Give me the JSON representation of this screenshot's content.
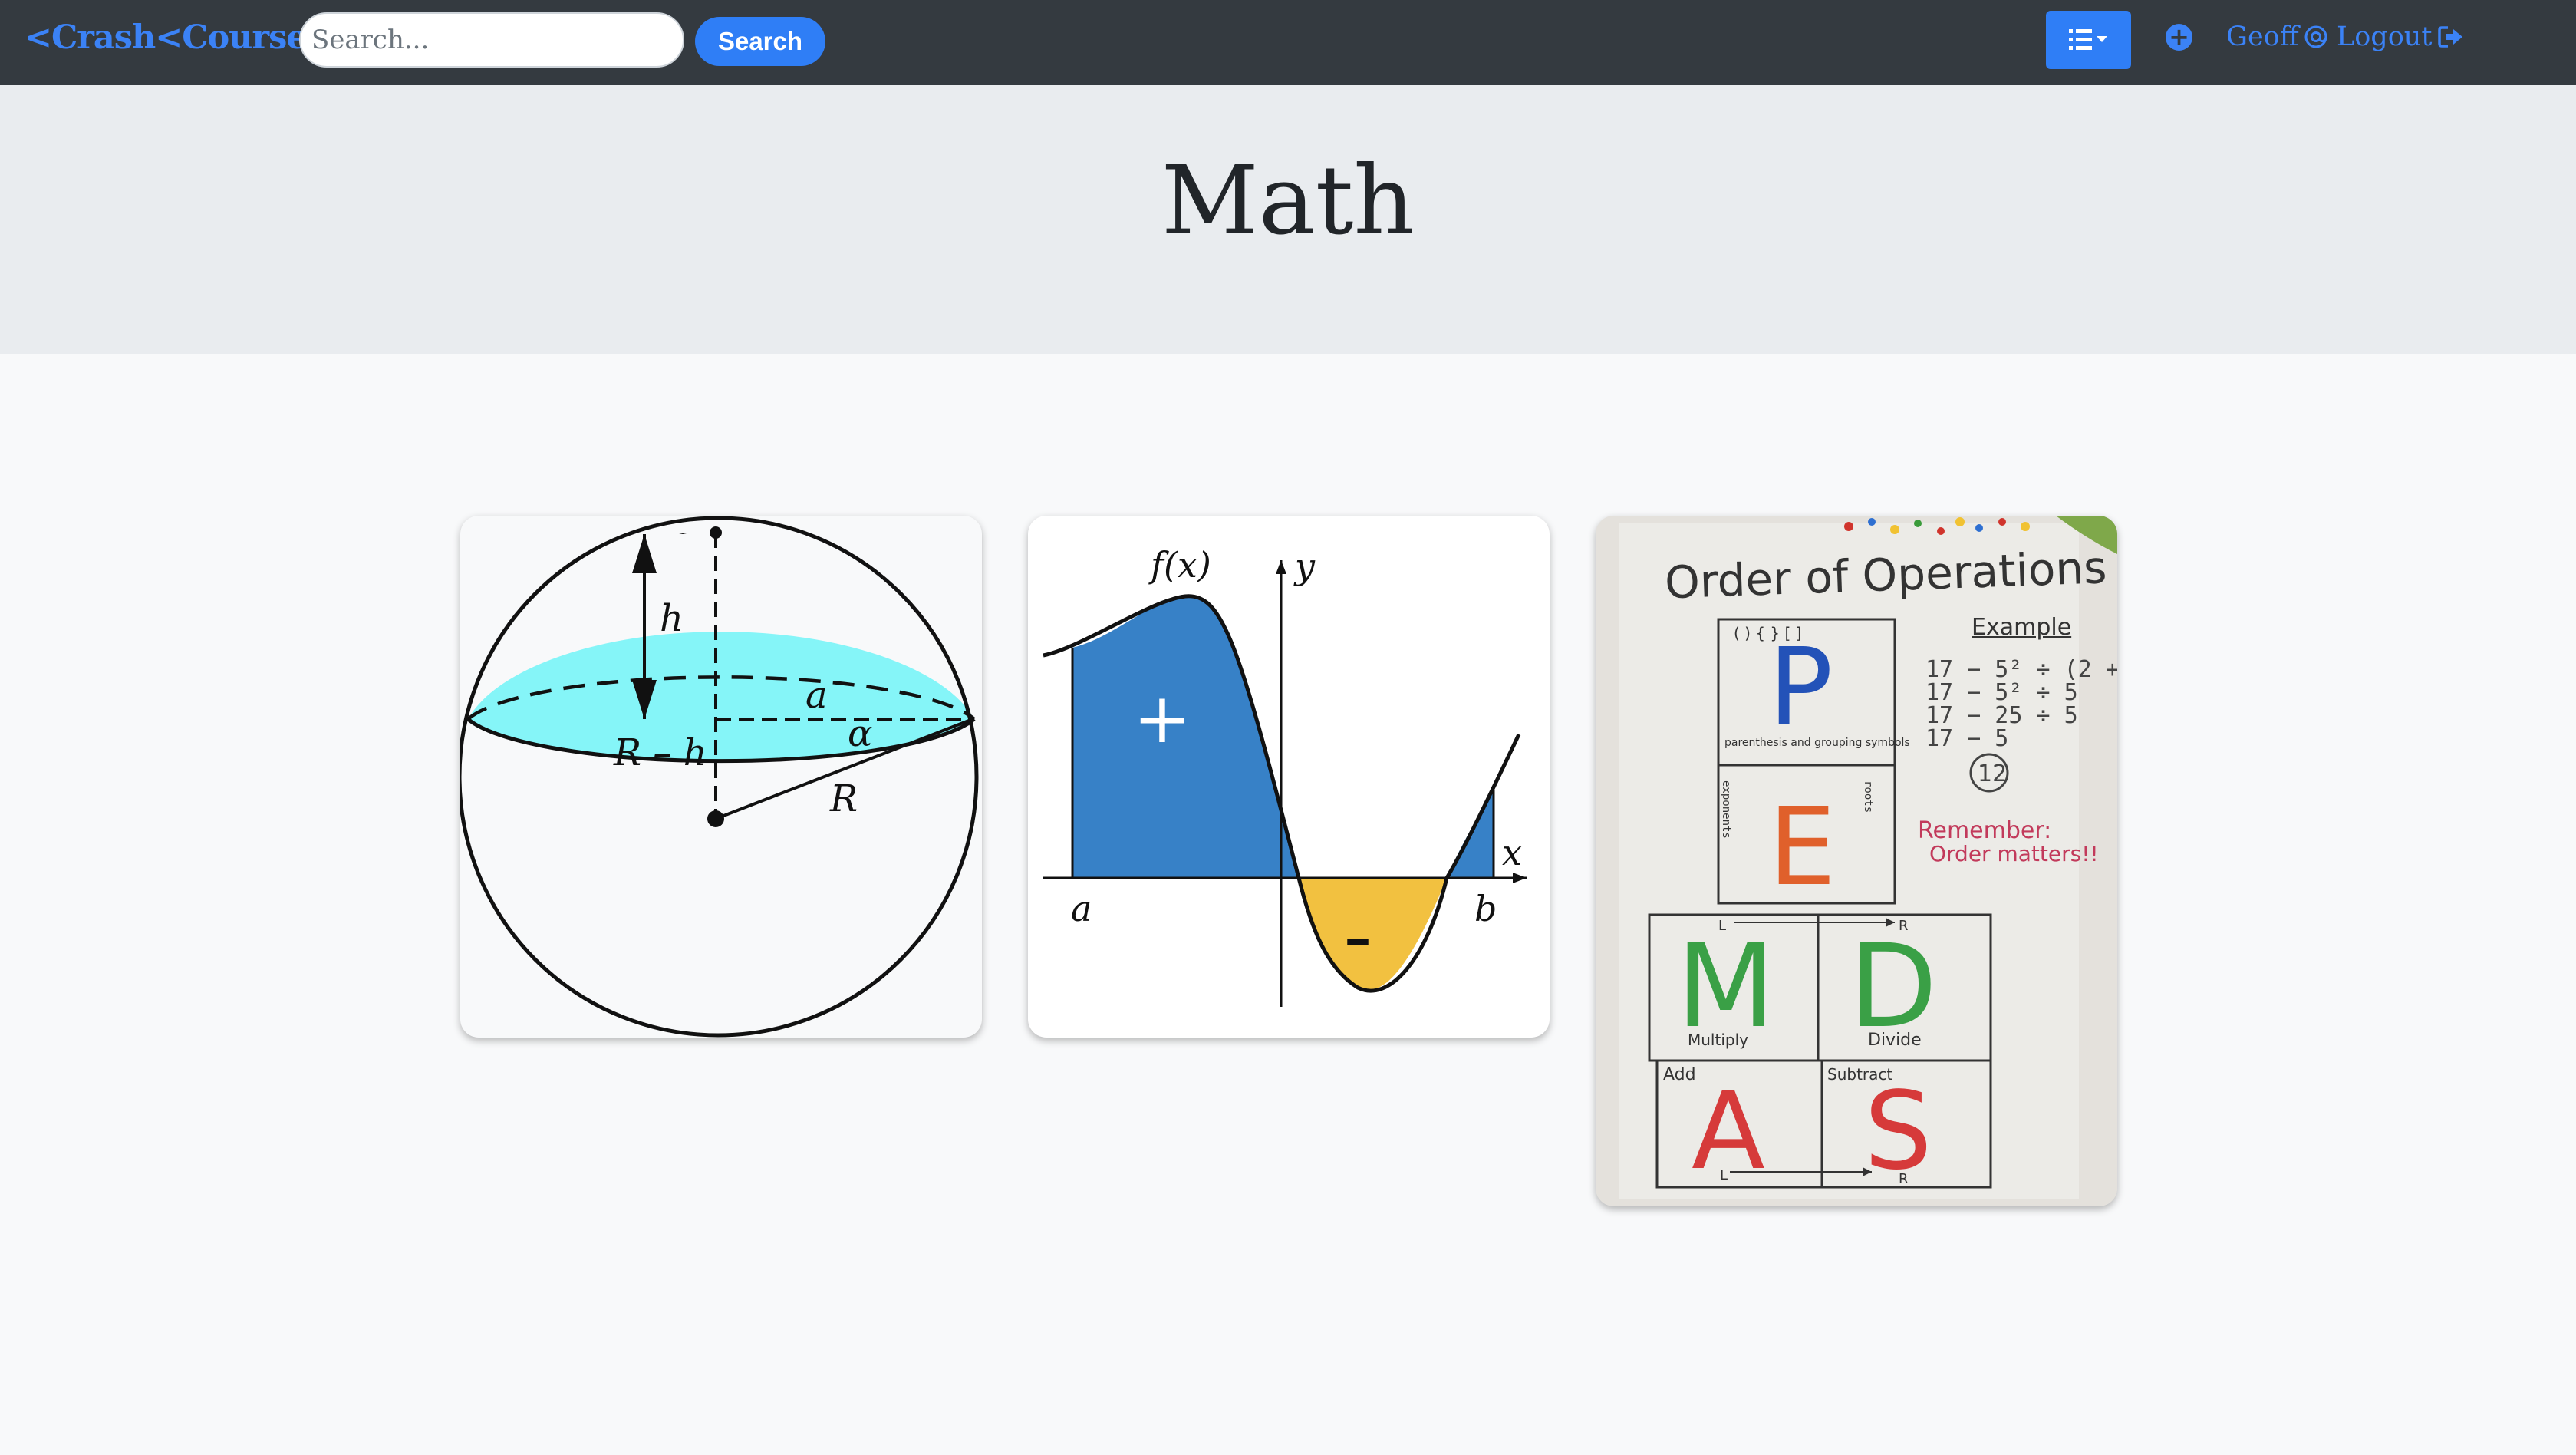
{
  "navbar": {
    "brand": "<Crash<Course",
    "search_placeholder": "Search...",
    "search_label": "Search",
    "user_label": "Geoff",
    "logout_label": "Logout"
  },
  "page": {
    "title": "Math"
  },
  "icons": {
    "menu": "list-icon",
    "add": "plus-circle-icon",
    "user": "at-icon",
    "logout": "sign-out-icon"
  },
  "colors": {
    "navbar_bg": "#343a40",
    "accent": "#2f7ef6",
    "hero_bg": "#e9ecef",
    "page_bg": "#f8f9fa"
  },
  "cards": [
    {
      "id": "sphere",
      "labels": {
        "h": "h",
        "a": "a",
        "alpha": "α",
        "r_minus_h": "R – h",
        "r": "R"
      }
    },
    {
      "id": "integral",
      "labels": {
        "fx": "f(x)",
        "y": "y",
        "x": "x",
        "a": "a",
        "b": "b",
        "plus": "+",
        "minus": "–"
      }
    },
    {
      "id": "order-of-operations",
      "labels": {
        "title": "Order of Operations",
        "example": "Example",
        "example_lines": [
          "17 − 5² ÷ (2 +",
          "17 − 5² ÷ 5",
          "17 − 25 ÷ 5",
          "17 − 5",
          "12"
        ],
        "p": "P",
        "p_desc": "parenthesis and grouping symbols",
        "p_symbols": "( )  { }  [ ]",
        "e": "E",
        "e_left": "exponents",
        "e_right": "roots",
        "remember": "Remember:",
        "order_matters": "Order matters!!",
        "m": "M",
        "multiply": "Multiply",
        "d": "D",
        "divide": "Divide",
        "a": "A",
        "add": "Add",
        "s": "S",
        "subtract": "Subtract",
        "l": "L",
        "r": "R"
      }
    }
  ]
}
